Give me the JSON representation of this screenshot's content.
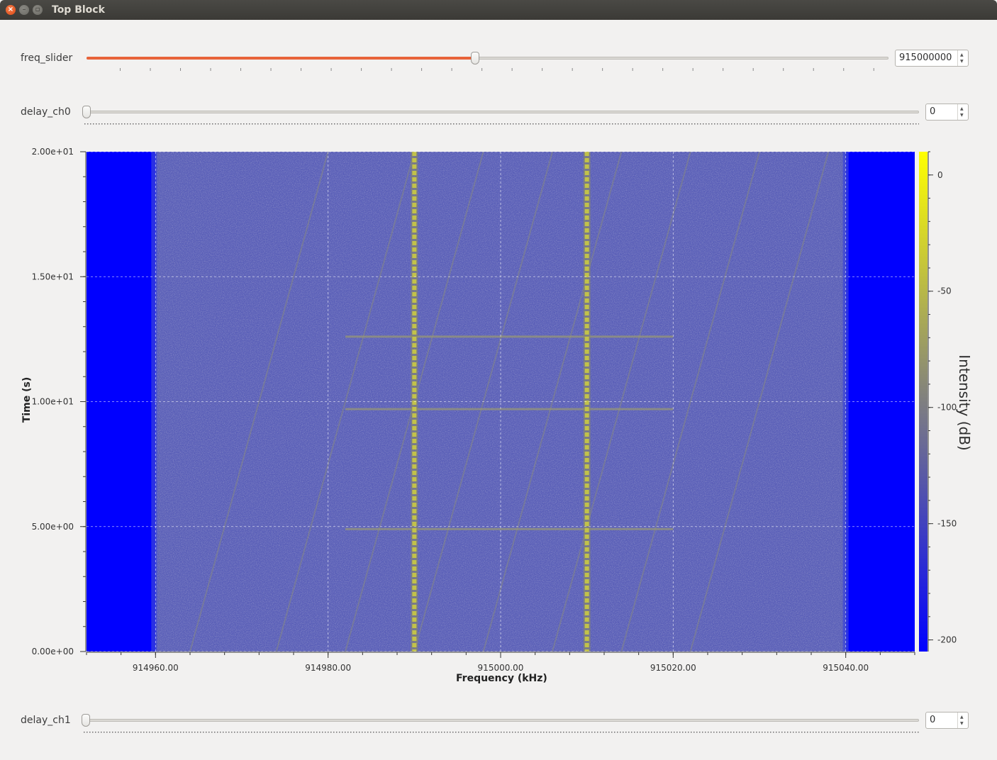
{
  "window": {
    "title": "Top Block"
  },
  "controls": {
    "freq_slider": {
      "label": "freq_slider",
      "value": "915000000",
      "position_fraction": 0.4845
    },
    "delay_ch0": {
      "label": "delay_ch0",
      "value": "0",
      "position_fraction": 0.0
    },
    "delay_ch1": {
      "label": "delay_ch1",
      "value": "0",
      "position_fraction": 0.0
    }
  },
  "icons": {
    "close": "close-icon",
    "minimize": "minimize-icon",
    "maximize": "maximize-icon"
  },
  "colors": {
    "slider_fill": "#e8633a",
    "low": "#0000ff",
    "high": "#ffff00"
  },
  "chart_data": {
    "type": "heatmap",
    "title": "",
    "xlabel": "Frequency (kHz)",
    "ylabel": "Time (s)",
    "colorbar_label": "Intensity (dB)",
    "xlim": [
      914952.0,
      915048.0
    ],
    "ylim": [
      0,
      20
    ],
    "x_ticks": [
      914960,
      914980,
      915000,
      915020,
      915040
    ],
    "x_tick_labels": [
      "914960.00",
      "914980.00",
      "915000.00",
      "915020.00",
      "915040.00"
    ],
    "y_ticks": [
      0,
      5,
      10,
      15,
      20
    ],
    "y_tick_labels": [
      "0.00e+00",
      "5.00e+00",
      "1.00e+01",
      "1.50e+01",
      "2.00e+01"
    ],
    "colorbar_range": [
      -205,
      10
    ],
    "colorbar_ticks": [
      0,
      -50,
      -100,
      -150,
      -200
    ],
    "colorbar_tick_labels": [
      "0",
      "-50",
      "-100",
      "-150",
      "-200"
    ],
    "grid": true,
    "passband_khz": [
      914960,
      915040
    ],
    "carriers_khz": [
      914990,
      915010
    ],
    "horizontal_bursts_s": [
      12.6,
      9.7,
      4.9
    ]
  }
}
